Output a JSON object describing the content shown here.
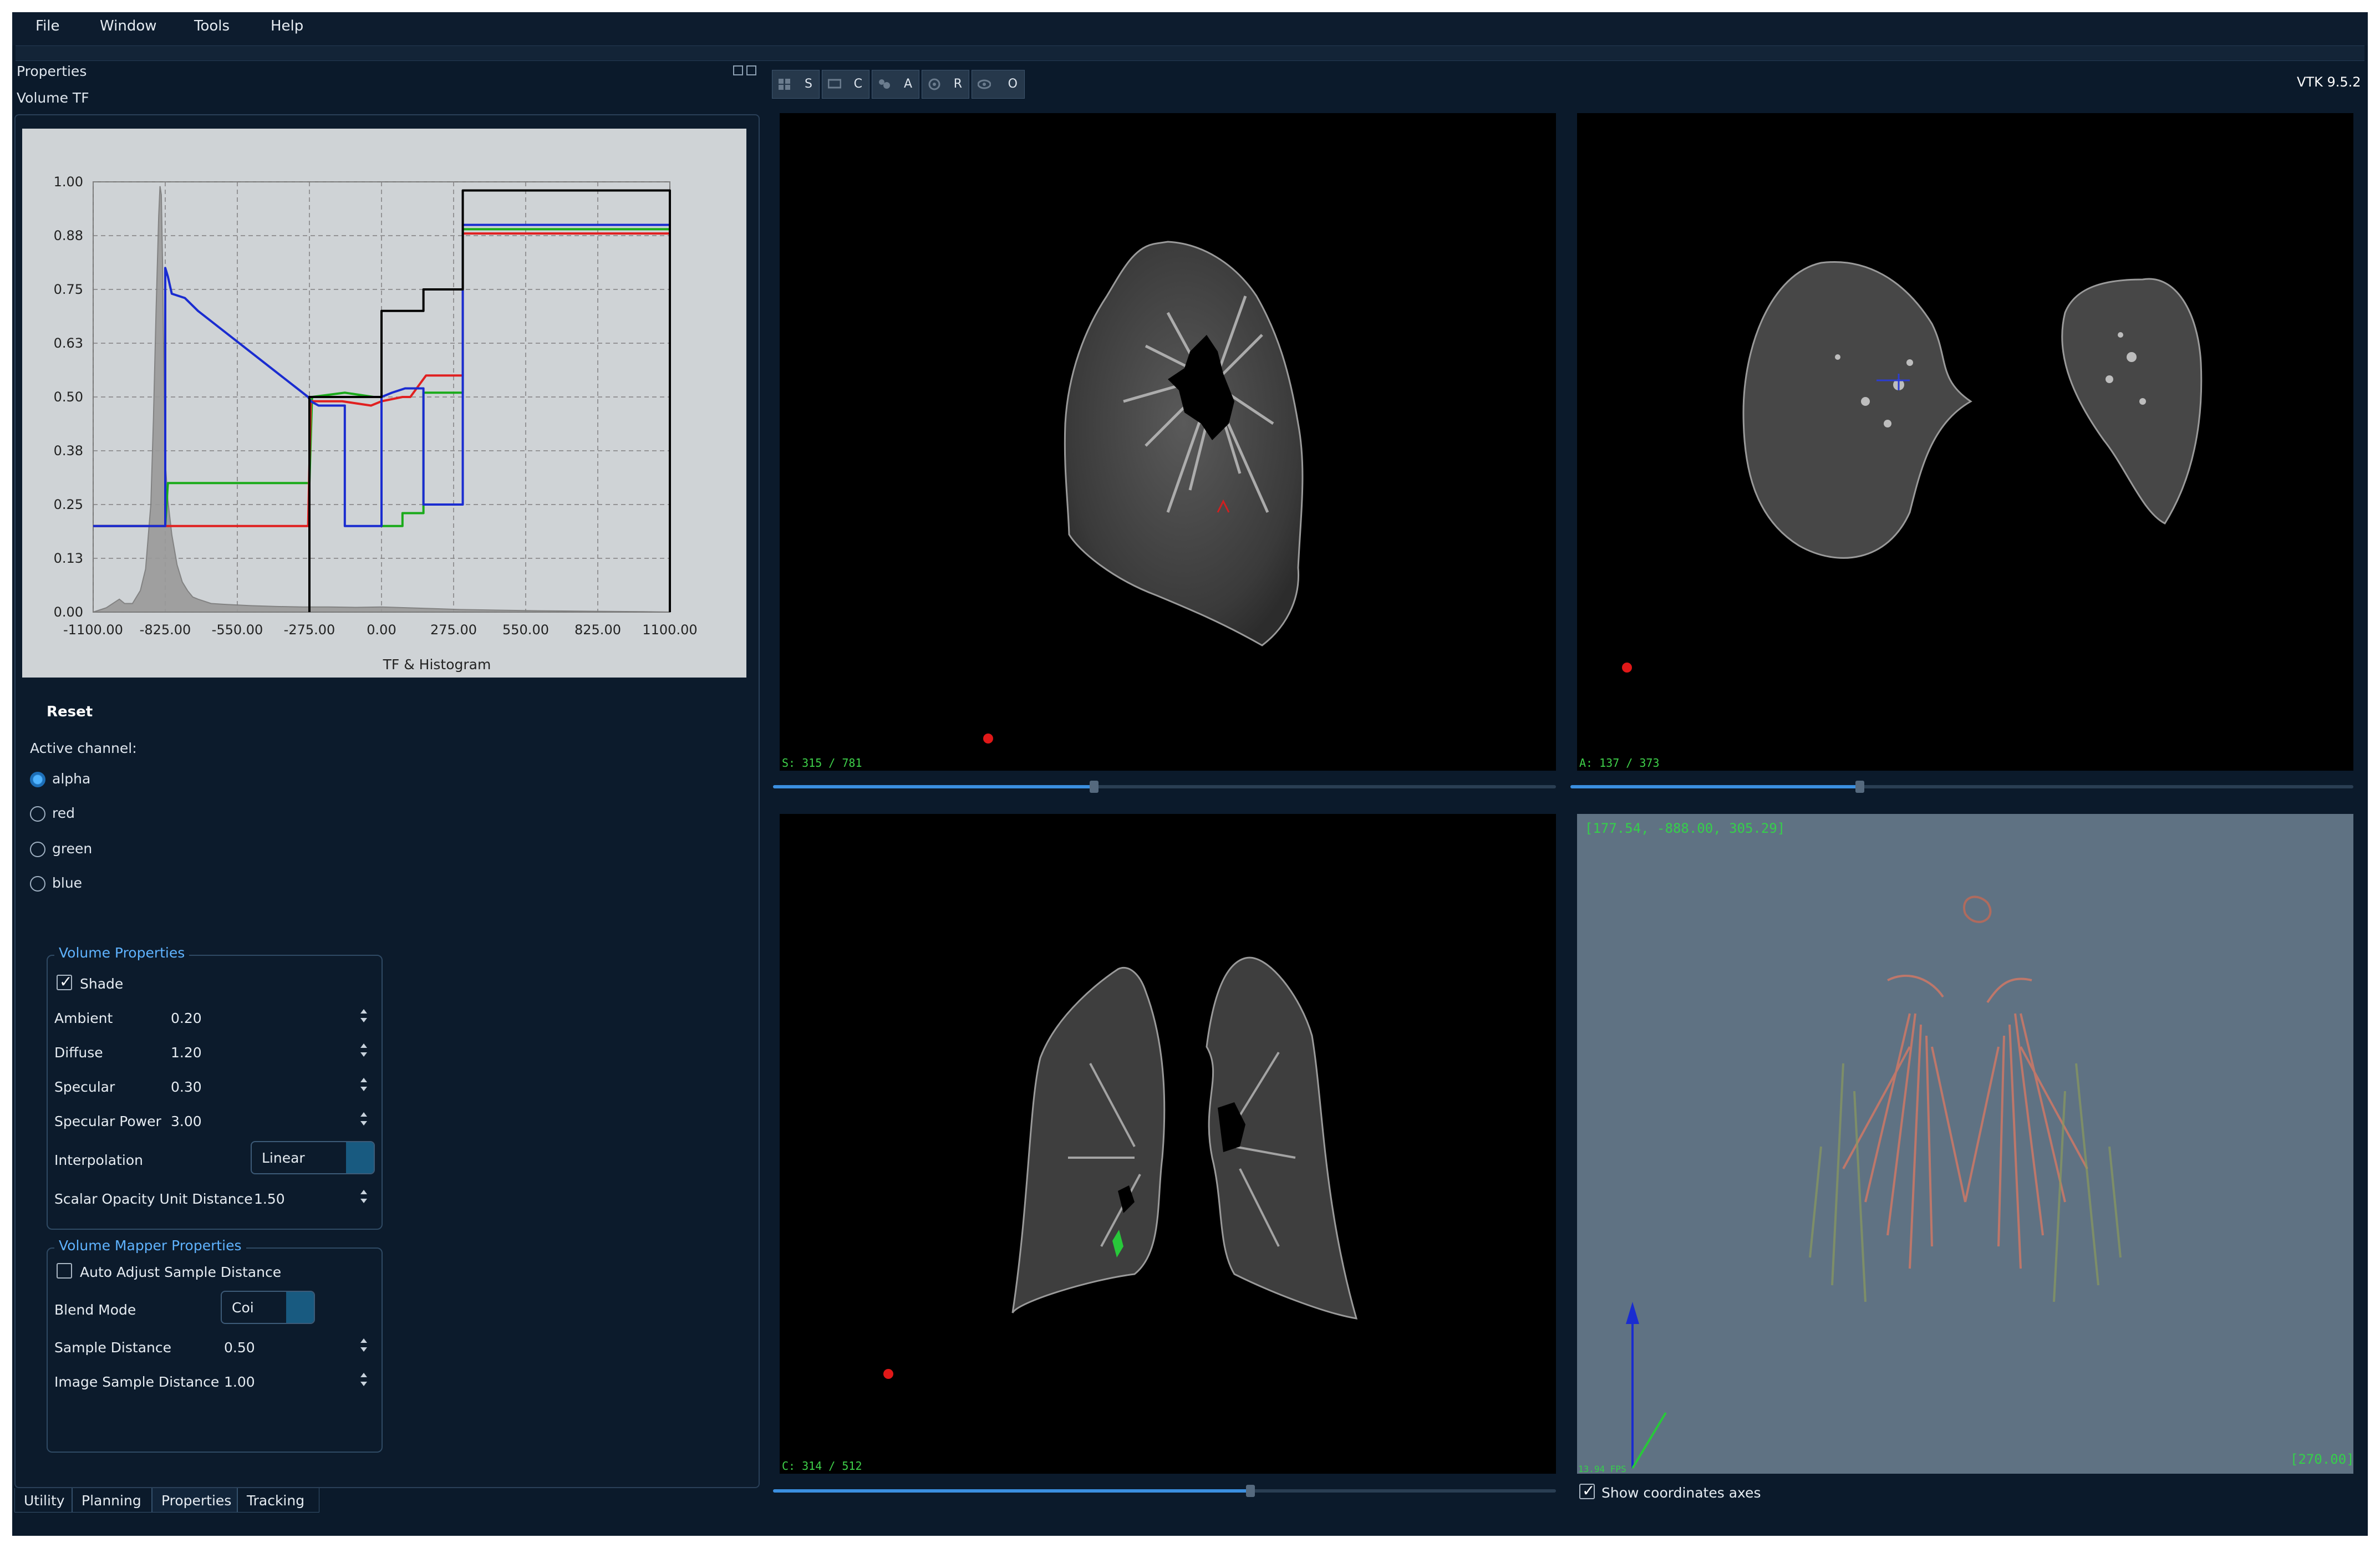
{
  "menu": {
    "items": [
      "File",
      "Window",
      "Tools",
      "Help"
    ]
  },
  "left_panel": {
    "title": "Properties",
    "section": "Volume TF",
    "reset_label": "Reset",
    "active_channel_label": "Active channel:",
    "channels": [
      {
        "label": "alpha",
        "selected": true
      },
      {
        "label": "red",
        "selected": false
      },
      {
        "label": "green",
        "selected": false
      },
      {
        "label": "blue",
        "selected": false
      }
    ],
    "volume_properties": {
      "title": "Volume Properties",
      "shade_label": "Shade",
      "shade_checked": true,
      "ambient": {
        "label": "Ambient",
        "value": "0.20"
      },
      "diffuse": {
        "label": "Diffuse",
        "value": "1.20"
      },
      "specular": {
        "label": "Specular",
        "value": "0.30"
      },
      "specular_power": {
        "label": "Specular Power",
        "value": "3.00"
      },
      "interpolation": {
        "label": "Interpolation",
        "value": "Linear"
      },
      "scalar_opacity": {
        "label": "Scalar Opacity Unit Distance",
        "value": "1.50"
      }
    },
    "mapper_properties": {
      "title": "Volume Mapper Properties",
      "auto_adjust_label": "Auto Adjust Sample Distance",
      "auto_adjust_checked": false,
      "blend_mode": {
        "label": "Blend Mode",
        "value": "Coi"
      },
      "sample_distance": {
        "label": "Sample Distance",
        "value": "0.50"
      },
      "image_sample_distance": {
        "label": "Image Sample Distance",
        "value": "1.00"
      }
    },
    "tabs": [
      {
        "label": "Utility",
        "active": false
      },
      {
        "label": "Planning",
        "active": false
      },
      {
        "label": "Properties",
        "active": true
      },
      {
        "label": "Tracking",
        "active": false
      }
    ]
  },
  "view_toolbar": {
    "buttons": [
      "S",
      "C",
      "A",
      "R",
      "O"
    ],
    "version": "VTK 9.5.2"
  },
  "views": {
    "sagittal": {
      "info": "S: 315 / 781",
      "slider_fraction": 0.41
    },
    "axial": {
      "info": "A: 137 / 373",
      "slider_fraction": 0.37
    },
    "coronal": {
      "info": "C: 314 / 512",
      "slider_fraction": 0.61
    },
    "render3d": {
      "coords": "[177.54, -888.00, 305.29]",
      "angle": "[270.00]",
      "fps": "13.94 FPS",
      "show_axes_label": "Show coordinates axes",
      "show_axes_checked": true
    }
  },
  "chart_data": {
    "type": "line",
    "xlabel": "TF & Histogram",
    "xlim": [
      -1100,
      1100
    ],
    "ylim": [
      0,
      1
    ],
    "grid": true,
    "x_ticks": [
      "-1100.00",
      "-825.00",
      "-550.00",
      "-275.00",
      "0.00",
      "275.00",
      "550.00",
      "825.00",
      "1100.00"
    ],
    "x_tick_values": [
      -1100,
      -825,
      -550,
      -275,
      0,
      275,
      550,
      825,
      1100
    ],
    "y_ticks": [
      "0.00",
      "0.13",
      "0.25",
      "0.38",
      "0.50",
      "0.63",
      "0.75",
      "0.88",
      "1.00"
    ],
    "y_tick_values": [
      0,
      0.125,
      0.25,
      0.375,
      0.5,
      0.625,
      0.75,
      0.875,
      1.0
    ],
    "histogram": {
      "x": [
        -1100,
        -1050,
        -1000,
        -980,
        -950,
        -920,
        -900,
        -880,
        -870,
        -860,
        -850,
        -845,
        -840,
        -835,
        -830,
        -825,
        -815,
        -800,
        -780,
        -760,
        -740,
        -720,
        -700,
        -650,
        -600,
        -500,
        -400,
        -300,
        -200,
        -100,
        0,
        100,
        200,
        300,
        400,
        600,
        800,
        1000,
        1100
      ],
      "y": [
        0,
        0.01,
        0.03,
        0.02,
        0.02,
        0.05,
        0.1,
        0.25,
        0.45,
        0.7,
        0.92,
        0.99,
        0.97,
        0.8,
        0.55,
        0.35,
        0.26,
        0.18,
        0.11,
        0.07,
        0.05,
        0.035,
        0.03,
        0.02,
        0.018,
        0.015,
        0.013,
        0.012,
        0.012,
        0.011,
        0.012,
        0.01,
        0.008,
        0.006,
        0.005,
        0.003,
        0.002,
        0.001,
        0
      ]
    },
    "series": [
      {
        "name": "alpha",
        "color": "#000000",
        "x": [
          -275,
          -275,
          -170,
          0,
          0,
          160,
          160,
          310,
          310,
          1100,
          1100
        ],
        "y": [
          0,
          0.5,
          0.5,
          0.5,
          0.7,
          0.7,
          0.75,
          0.75,
          0.98,
          0.98,
          0
        ]
      },
      {
        "name": "red",
        "color": "#e02020",
        "x": [
          -1100,
          -280,
          -270,
          -150,
          -40,
          0,
          80,
          110,
          170,
          220,
          310,
          310,
          1100,
          1100
        ],
        "y": [
          0.2,
          0.2,
          0.49,
          0.49,
          0.48,
          0.49,
          0.5,
          0.5,
          0.55,
          0.55,
          0.55,
          0.88,
          0.88,
          0
        ]
      },
      {
        "name": "green",
        "color": "#1aaa1a",
        "x": [
          -1100,
          -825,
          -815,
          -275,
          -265,
          -140,
          -30,
          0,
          0,
          80,
          80,
          160,
          160,
          310,
          310,
          1100,
          1100
        ],
        "y": [
          0.2,
          0.2,
          0.3,
          0.3,
          0.5,
          0.51,
          0.5,
          0.5,
          0.2,
          0.2,
          0.23,
          0.23,
          0.51,
          0.51,
          0.89,
          0.89,
          0
        ]
      },
      {
        "name": "blue",
        "color": "#1a2cd0",
        "x": [
          -1100,
          -825,
          -825,
          -815,
          -800,
          -750,
          -700,
          -280,
          -270,
          -240,
          -140,
          -140,
          0,
          0,
          40,
          90,
          160,
          160,
          310,
          310,
          1100,
          1100
        ],
        "y": [
          0.2,
          0.2,
          0.8,
          0.78,
          0.74,
          0.73,
          0.7,
          0.5,
          0.49,
          0.48,
          0.48,
          0.2,
          0.2,
          0.5,
          0.51,
          0.52,
          0.52,
          0.25,
          0.25,
          0.9,
          0.9,
          0
        ]
      }
    ]
  }
}
